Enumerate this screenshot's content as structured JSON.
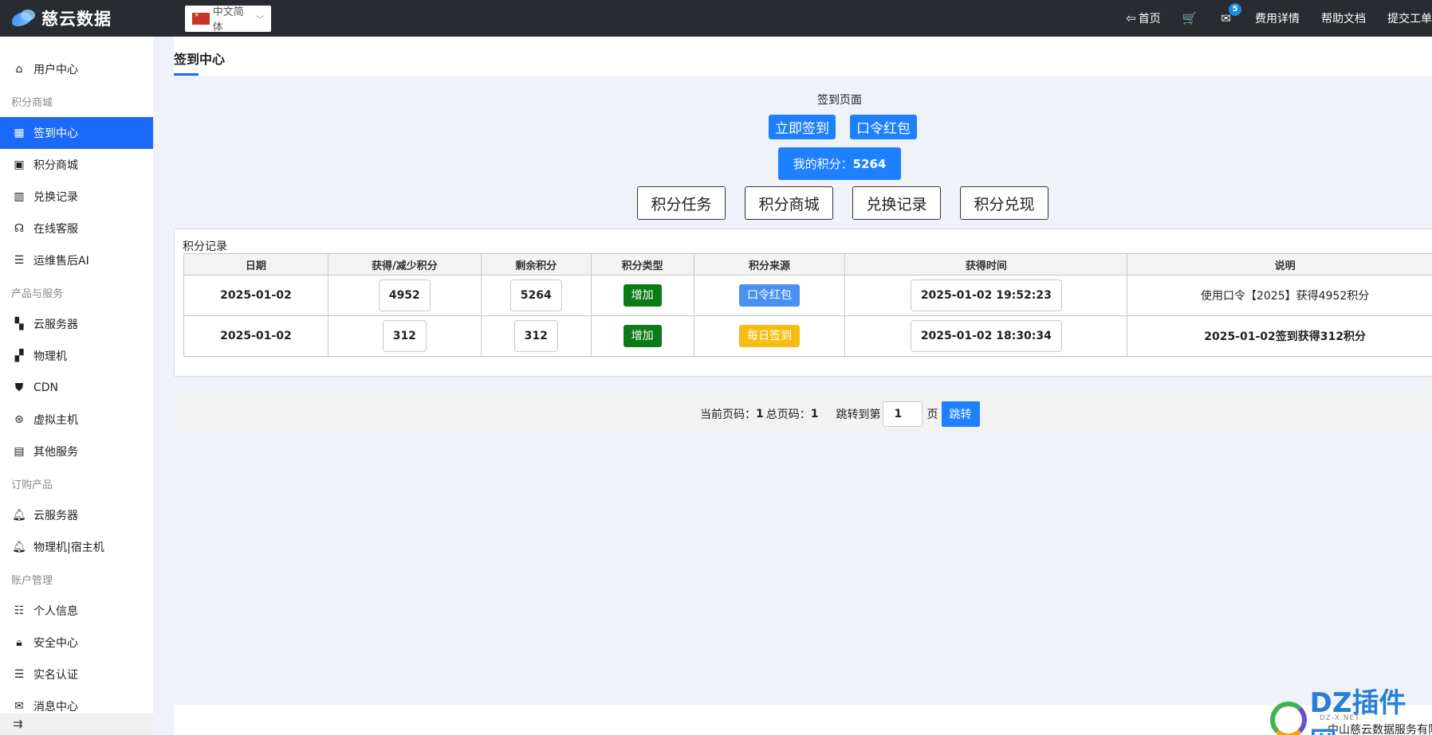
{
  "topbar": {
    "logo_text": "慈云数据",
    "lang_label": "中文简体",
    "nav": {
      "home": "首页",
      "mail_badge": "5",
      "billing": "费用详情",
      "help": "帮助文档",
      "ticket": "提交工单"
    }
  },
  "sidebar": {
    "user_center": "用户中心",
    "group_points": "积分商城",
    "signin_center": "签到中心",
    "points_mall": "积分商城",
    "exchange_record": "兑换记录",
    "online_service": "在线客服",
    "ops_ai": "运维售后AI",
    "group_products": "产品与服务",
    "cloud_server": "云服务器",
    "physical": "物理机",
    "cdn": "CDN",
    "virtual_host": "虚拟主机",
    "other_service": "其他服务",
    "group_order": "订购产品",
    "order_cloud": "云服务器",
    "order_physical": "物理机|宿主机",
    "group_account": "账户管理",
    "personal_info": "个人信息",
    "security": "安全中心",
    "realname": "实名认证",
    "messages": "消息中心",
    "bottom_icon": "⇉"
  },
  "page": {
    "title": "签到中心"
  },
  "signin": {
    "label": "签到页面",
    "sign_now": "立即签到",
    "redpacket": "口令红包",
    "my_points_label": "我的积分：",
    "my_points_value": "5264",
    "points_task": "积分任务",
    "points_mall": "积分商城",
    "exchange_record": "兑换记录",
    "points_cash": "积分兑现"
  },
  "records": {
    "title": "积分记录",
    "headers": [
      "日期",
      "获得/减少积分",
      "剩余积分",
      "积分类型",
      "积分来源",
      "获得时间",
      "说明"
    ],
    "rows": [
      {
        "date": "2025-01-02",
        "delta": "4952",
        "remaining": "5264",
        "type": "增加",
        "source": "口令红包",
        "time": "2025-01-02 19:52:23",
        "desc": "使用口令【2025】获得4952积分"
      },
      {
        "date": "2025-01-02",
        "delta": "312",
        "remaining": "312",
        "type": "增加",
        "source": "每日签到",
        "time": "2025-01-02 18:30:34",
        "desc": "2025-01-02签到获得312积分"
      }
    ]
  },
  "pager": {
    "current_label": "当前页码：",
    "current": "1",
    "total_label": "总页码：",
    "total": "1",
    "jump_label": "跳转到第",
    "jump_value": "1",
    "page_unit": "页",
    "jump_button": "跳转"
  },
  "footer": {
    "text": "中山慈云数据服务有限"
  },
  "watermark": {
    "text": "DZ插件网",
    "sub": "DZ-X.NET"
  }
}
